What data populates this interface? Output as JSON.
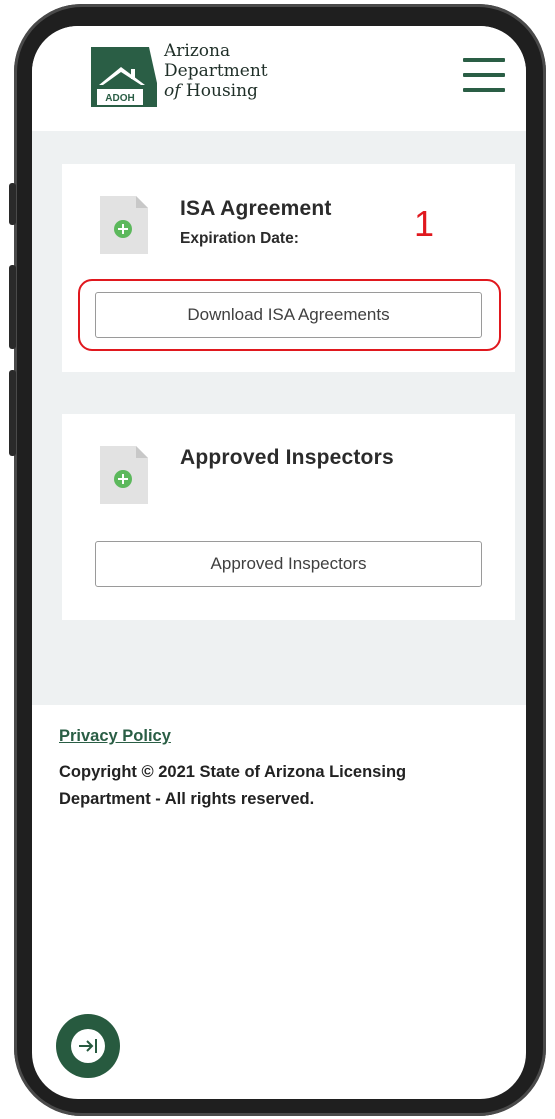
{
  "header": {
    "logo_badge": "ADOH",
    "logo_line1": "Arizona",
    "logo_line2": "Department",
    "logo_line3_italic": "of",
    "logo_line3_rest": " Housing",
    "menu_icon": "hamburger-menu-icon"
  },
  "cards": [
    {
      "icon": "document-add-icon",
      "title": "ISA Agreement",
      "subtitle": "Expiration Date:",
      "button_label": "Download ISA Agreements"
    },
    {
      "icon": "document-add-icon",
      "title": "Approved Inspectors",
      "button_label": "Approved Inspectors"
    }
  ],
  "annotation": {
    "step_number": "1",
    "color": "#e0181e"
  },
  "footer": {
    "privacy_link": "Privacy Policy",
    "copyright": "Copyright © 2021 State of Arizona Licensing Department - All rights reserved."
  },
  "fab": {
    "icon": "expand-panel-icon"
  },
  "colors": {
    "brand_green": "#2a5e45",
    "icon_green": "#5cb85c",
    "page_bg": "#eef1f2"
  }
}
